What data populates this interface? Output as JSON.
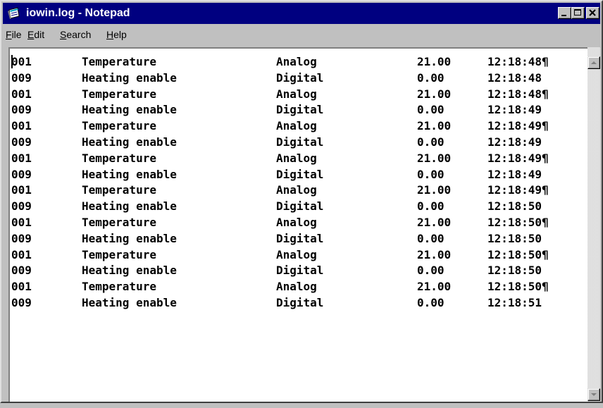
{
  "window": {
    "title": "iowin.log - Notepad",
    "icons": {
      "app": "notepad-icon",
      "minimize": "minimize-icon",
      "maximize": "maximize-icon",
      "close": "close-icon"
    },
    "colors": {
      "titlebar": "#000080",
      "chrome": "#c0c0c0"
    }
  },
  "menu": {
    "file": {
      "mnemonic": "F",
      "rest": "ile"
    },
    "edit": {
      "mnemonic": "E",
      "rest": "dit"
    },
    "search": {
      "mnemonic": "S",
      "rest": "earch"
    },
    "help": {
      "mnemonic": "H",
      "rest": "elp"
    }
  },
  "document": {
    "lines": [
      {
        "id": "001",
        "name": "Temperature",
        "type": "Analog",
        "value": "21.00",
        "time": "12:18:48¶"
      },
      {
        "id": "009",
        "name": "Heating enable",
        "type": "Digital",
        "value": "0.00",
        "time": "12:18:48"
      },
      {
        "id": "001",
        "name": "Temperature",
        "type": "Analog",
        "value": "21.00",
        "time": "12:18:48¶"
      },
      {
        "id": "009",
        "name": "Heating enable",
        "type": "Digital",
        "value": "0.00",
        "time": "12:18:49"
      },
      {
        "id": "001",
        "name": "Temperature",
        "type": "Analog",
        "value": "21.00",
        "time": "12:18:49¶"
      },
      {
        "id": "009",
        "name": "Heating enable",
        "type": "Digital",
        "value": "0.00",
        "time": "12:18:49"
      },
      {
        "id": "001",
        "name": "Temperature",
        "type": "Analog",
        "value": "21.00",
        "time": "12:18:49¶"
      },
      {
        "id": "009",
        "name": "Heating enable",
        "type": "Digital",
        "value": "0.00",
        "time": "12:18:49"
      },
      {
        "id": "001",
        "name": "Temperature",
        "type": "Analog",
        "value": "21.00",
        "time": "12:18:49¶"
      },
      {
        "id": "009",
        "name": "Heating enable",
        "type": "Digital",
        "value": "0.00",
        "time": "12:18:50"
      },
      {
        "id": "001",
        "name": "Temperature",
        "type": "Analog",
        "value": "21.00",
        "time": "12:18:50¶"
      },
      {
        "id": "009",
        "name": "Heating enable",
        "type": "Digital",
        "value": "0.00",
        "time": "12:18:50"
      },
      {
        "id": "001",
        "name": "Temperature",
        "type": "Analog",
        "value": "21.00",
        "time": "12:18:50¶"
      },
      {
        "id": "009",
        "name": "Heating enable",
        "type": "Digital",
        "value": "0.00",
        "time": "12:18:50"
      },
      {
        "id": "001",
        "name": "Temperature",
        "type": "Analog",
        "value": "21.00",
        "time": "12:18:50¶"
      },
      {
        "id": "009",
        "name": "Heating enable",
        "type": "Digital",
        "value": "0.00",
        "time": "12:18:51"
      }
    ]
  },
  "scrollbar": {
    "up_icon": "scroll-up-arrow-icon",
    "down_icon": "scroll-down-arrow-icon"
  }
}
